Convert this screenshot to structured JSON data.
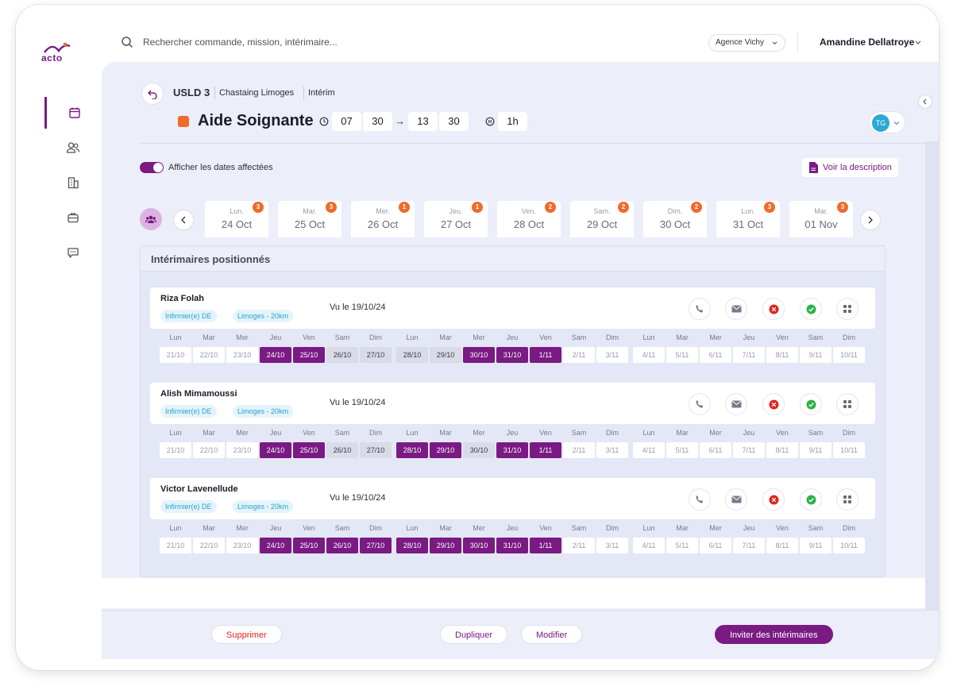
{
  "brand": {
    "logo_text": "acto",
    "accent": "#7a1a83",
    "orange": "#f06b2a"
  },
  "search": {
    "placeholder": "Rechercher commande, mission, intérimaire..."
  },
  "agency": "Agence Vichy",
  "user": "Amandine Dellatroye",
  "breadcrumb": [
    "USLD 3",
    "Chastaing Limoges",
    "Intérim"
  ],
  "job": {
    "title": "Aide Soignante",
    "start_h": "07",
    "start_m": "30",
    "end_h": "13",
    "end_m": "30",
    "pause": "1h"
  },
  "avatar_initials": "TG",
  "toggle_label": "Afficher les dates affectées",
  "description_button": "Voir la description",
  "date_tabs": [
    {
      "day": "Lun.",
      "date": "24 Oct",
      "count": "3"
    },
    {
      "day": "Mar.",
      "date": "25 Oct",
      "count": "3"
    },
    {
      "day": "Mer.",
      "date": "26 Oct",
      "count": "1"
    },
    {
      "day": "Jeu.",
      "date": "27 Oct",
      "count": "1"
    },
    {
      "day": "Ven.",
      "date": "28 Oct",
      "count": "2"
    },
    {
      "day": "Sam.",
      "date": "29 Oct",
      "count": "2"
    },
    {
      "day": "Dim.",
      "date": "30 Oct",
      "count": "2"
    },
    {
      "day": "Lun.",
      "date": "31 Oct",
      "count": "3"
    },
    {
      "day": "Mar.",
      "date": "01 Nov",
      "count": "3"
    }
  ],
  "panel_title": "Intérimaires positionnés",
  "weekdays": [
    "Lun",
    "Mar",
    "Mer",
    "Jeu",
    "Ven",
    "Sam",
    "Dim",
    "Lun",
    "Mar",
    "Mer",
    "Jeu",
    "Ven",
    "Sam",
    "Dim",
    "Lun",
    "Mar",
    "Mer",
    "Jeu",
    "Ven",
    "Sam",
    "Dim"
  ],
  "dates": [
    "21/10",
    "22/10",
    "23/10",
    "24/10",
    "25/10",
    "26/10",
    "27/10",
    "28/10",
    "29/10",
    "30/10",
    "31/10",
    "1/11",
    "2/11",
    "3/11",
    "4/11",
    "5/11",
    "6/11",
    "7/11",
    "8/11",
    "9/11",
    "10/11"
  ],
  "candidates": [
    {
      "name": "Riza Folah",
      "chips": [
        "Infirmier(e) DE",
        "Limoges - 20km"
      ],
      "seen": "Vu le 19/10/24",
      "states": [
        "empty",
        "empty",
        "empty",
        "sel",
        "sel",
        "grey",
        "grey",
        "grey",
        "grey",
        "sel",
        "sel",
        "sel",
        "empty",
        "empty",
        "empty",
        "empty",
        "empty",
        "empty",
        "empty",
        "empty",
        "empty"
      ]
    },
    {
      "name": "Alish Mimamoussi",
      "chips": [
        "Infirmier(e) DE",
        "Limoges - 20km"
      ],
      "seen": "Vu le 19/10/24",
      "states": [
        "empty",
        "empty",
        "empty",
        "sel",
        "sel",
        "grey",
        "grey",
        "sel",
        "sel",
        "grey",
        "sel",
        "sel",
        "empty",
        "empty",
        "empty",
        "empty",
        "empty",
        "empty",
        "empty",
        "empty",
        "empty"
      ]
    },
    {
      "name": "Victor Lavenellude",
      "chips": [
        "Infirmier(e) DE",
        "Limoges - 20km"
      ],
      "seen": "Vu le 19/10/24",
      "states": [
        "empty",
        "empty",
        "empty",
        "sel",
        "sel",
        "sel",
        "sel",
        "sel",
        "sel",
        "sel",
        "sel",
        "sel",
        "empty",
        "empty",
        "empty",
        "empty",
        "empty",
        "empty",
        "empty",
        "empty",
        "empty"
      ]
    }
  ],
  "footer": {
    "delete": "Supprimer",
    "duplicate": "Dupliquer",
    "edit": "Modifier",
    "invite": "Inviter des intérimaires"
  }
}
